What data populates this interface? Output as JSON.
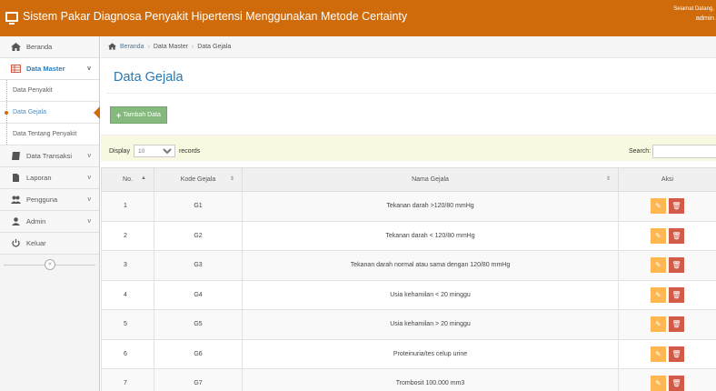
{
  "app": {
    "title": "Sistem Pakar Diagnosa Penyakit Hipertensi Menggunakan Metode Certainty",
    "greeting": "Selamat Datang,",
    "username": "admin"
  },
  "sidebar": {
    "items": [
      {
        "label": "Beranda"
      },
      {
        "label": "Data Master",
        "chevron": "v"
      },
      {
        "label": "Data Penyakit"
      },
      {
        "label": "Data Gejala"
      },
      {
        "label": "Data Tentang Penyakit"
      },
      {
        "label": "Data Transaksi",
        "chevron": "v"
      },
      {
        "label": "Laporan",
        "chevron": "v"
      },
      {
        "label": "Pengguna",
        "chevron": "v"
      },
      {
        "label": "Admin",
        "chevron": "v"
      },
      {
        "label": "Keluar"
      }
    ],
    "collapse_glyph": "«"
  },
  "breadcrumb": {
    "home": "Beranda",
    "sep": "›",
    "level1": "Data Master",
    "level2": "Data Gejala"
  },
  "page": {
    "title": "Data Gejala",
    "add_button": "Tambah Data",
    "plus": "+"
  },
  "filter": {
    "display_label": "Display",
    "records_label": "records",
    "page_size": "10",
    "search_label": "Search:"
  },
  "table": {
    "headers": {
      "no": "No.",
      "kode": "Kode Gejala",
      "nama": "Nama Gejala",
      "aksi": "Aksi"
    },
    "sort_asc": "▲",
    "sort_both": "⇕",
    "edit_glyph": "✎",
    "delete_glyph": "🗑",
    "rows": [
      {
        "no": "1",
        "kode": "G1",
        "nama": "Tekanan darah >120/80 mmHg"
      },
      {
        "no": "2",
        "kode": "G2",
        "nama": "Tekanan darah < 120/80 mmHg"
      },
      {
        "no": "3",
        "kode": "G3",
        "nama": "Tekanan darah normal atau sama dengan 120/80 mmHg"
      },
      {
        "no": "4",
        "kode": "G4",
        "nama": "Usia kehamilan < 20 minggu"
      },
      {
        "no": "5",
        "kode": "G5",
        "nama": "Usia kehamilan > 20 minggu"
      },
      {
        "no": "6",
        "kode": "G6",
        "nama": "Proteinuria/tes celup urine"
      },
      {
        "no": "7",
        "kode": "G7",
        "nama": "Trombosit 100.000 mm3"
      }
    ]
  },
  "colors": {
    "topbar": "#cf6b0b",
    "add_button": "#87b87f",
    "edit": "#ffb752",
    "delete": "#d15b47",
    "title": "#2679b5"
  }
}
